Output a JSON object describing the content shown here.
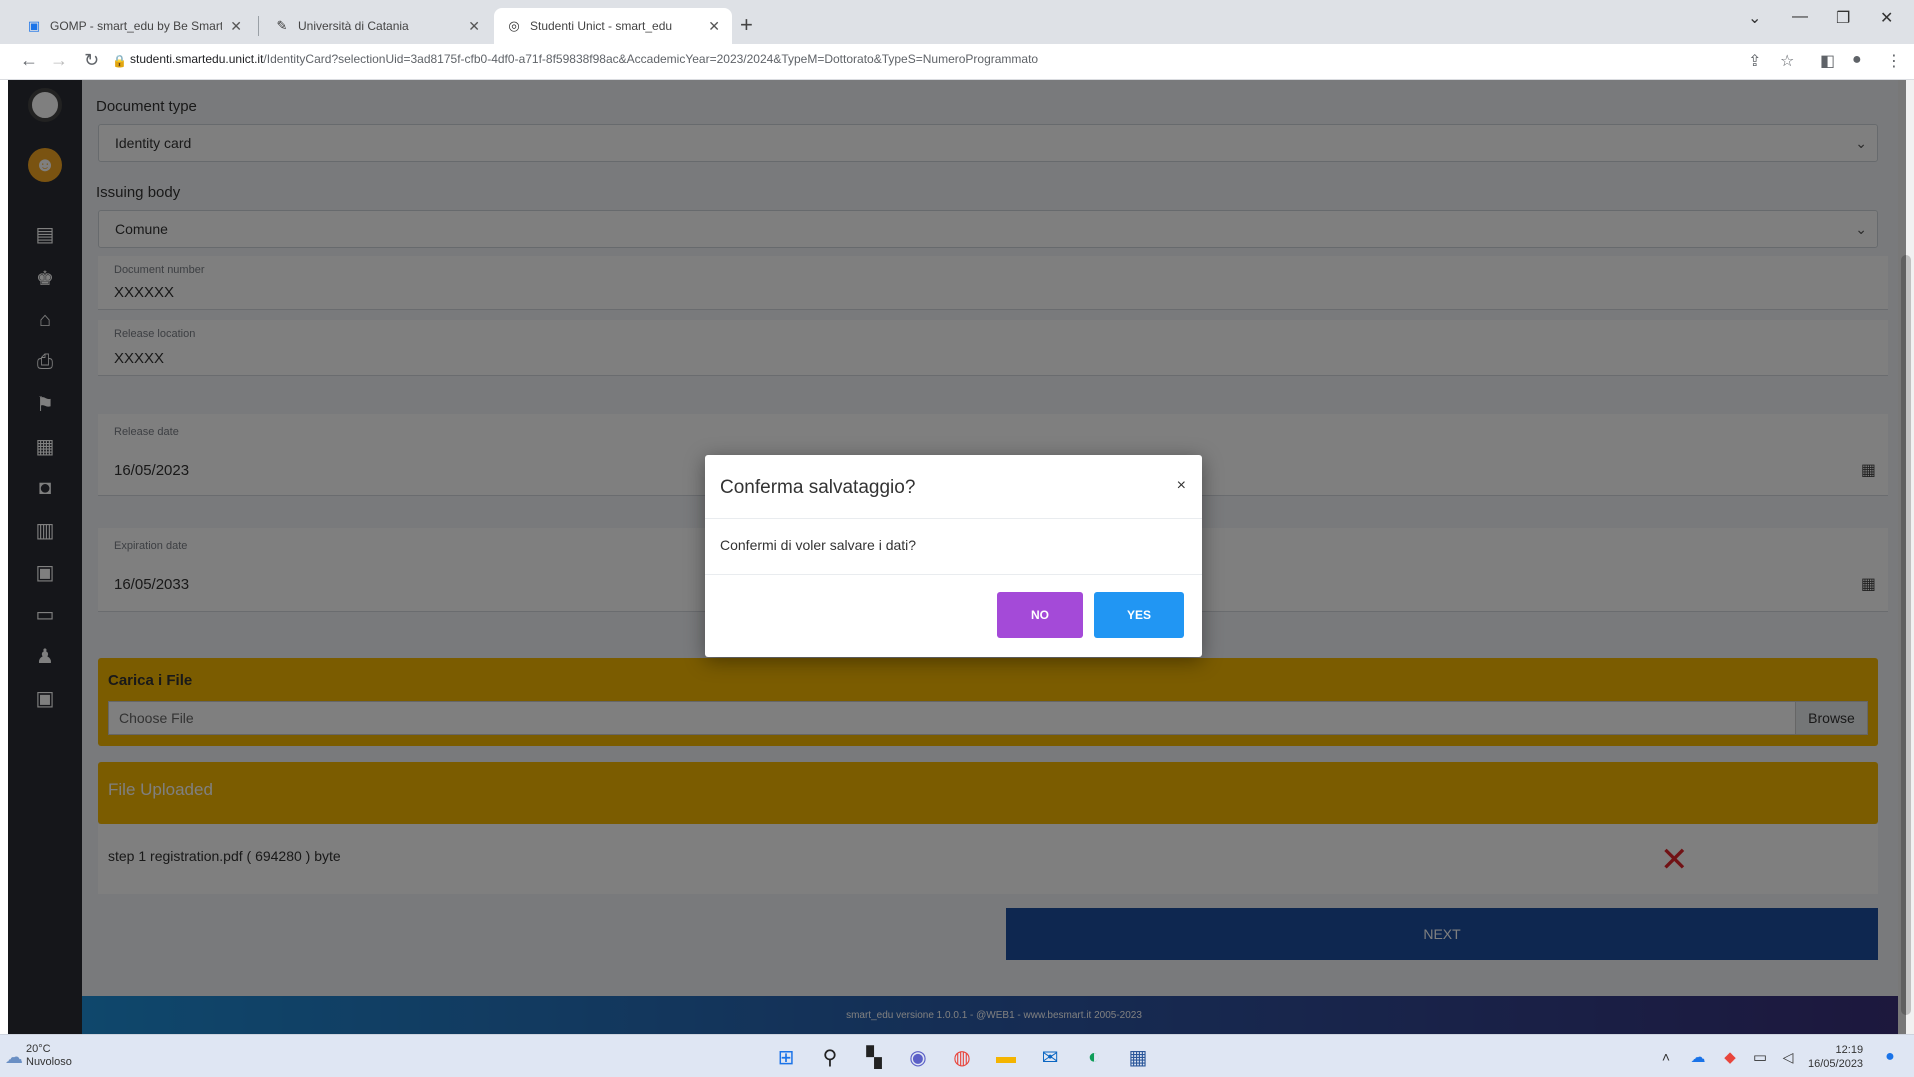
{
  "browser": {
    "tabs": [
      {
        "label": "GOMP - smart_edu by Be Smart",
        "icon": "gomp-icon"
      },
      {
        "label": "Università di Catania",
        "icon": "unict-icon"
      },
      {
        "label": "Studenti Unict - smart_edu",
        "icon": "globe-icon"
      }
    ],
    "new_tab": "+",
    "url_host": "studenti.smartedu.unict.it",
    "url_path": "/IdentityCard?selectionUid=3ad8175f-cfb0-4df0-a71f-8f59838f98ac&AccademicYear=2023/2024&TypeM=Dottorato&TypeS=NumeroProgrammato"
  },
  "form": {
    "document_type_label": "Document type",
    "document_type_value": "Identity card",
    "issuing_body_label": "Issuing body",
    "issuing_body_value": "Comune",
    "document_number_label": "Document number",
    "document_number_value": "XXXXXX",
    "release_location_label": "Release location",
    "release_location_value": "XXXXX",
    "release_date_label": "Release date",
    "release_date_value": "16/05/2023",
    "expiration_date_label": "Expiration date",
    "expiration_date_value": "16/05/2033"
  },
  "upload": {
    "title": "Carica i File",
    "placeholder": "Choose File",
    "browse": "Browse"
  },
  "uploaded": {
    "title": "File Uploaded",
    "file": "step 1 registration.pdf ( 694280 ) byte"
  },
  "next_button": "NEXT",
  "footer": "smart_edu versione 1.0.0.1 - @WEB1 - www.besmart.it 2005-2023",
  "modal": {
    "title": "Conferma salvataggio?",
    "close": "×",
    "message": "Confermi di voler salvare i dati?",
    "no": "NO",
    "yes": "YES"
  },
  "taskbar": {
    "temperature": "20°C",
    "weather": "Nuvoloso",
    "time": "12:19",
    "date": "16/05/2023"
  },
  "colors": {
    "sidebar": "#2a2d34",
    "upload_bar": "#f6b800",
    "next_button": "#1d4fa0",
    "no_button": "#a44ad8",
    "yes_button": "#2196f3"
  }
}
